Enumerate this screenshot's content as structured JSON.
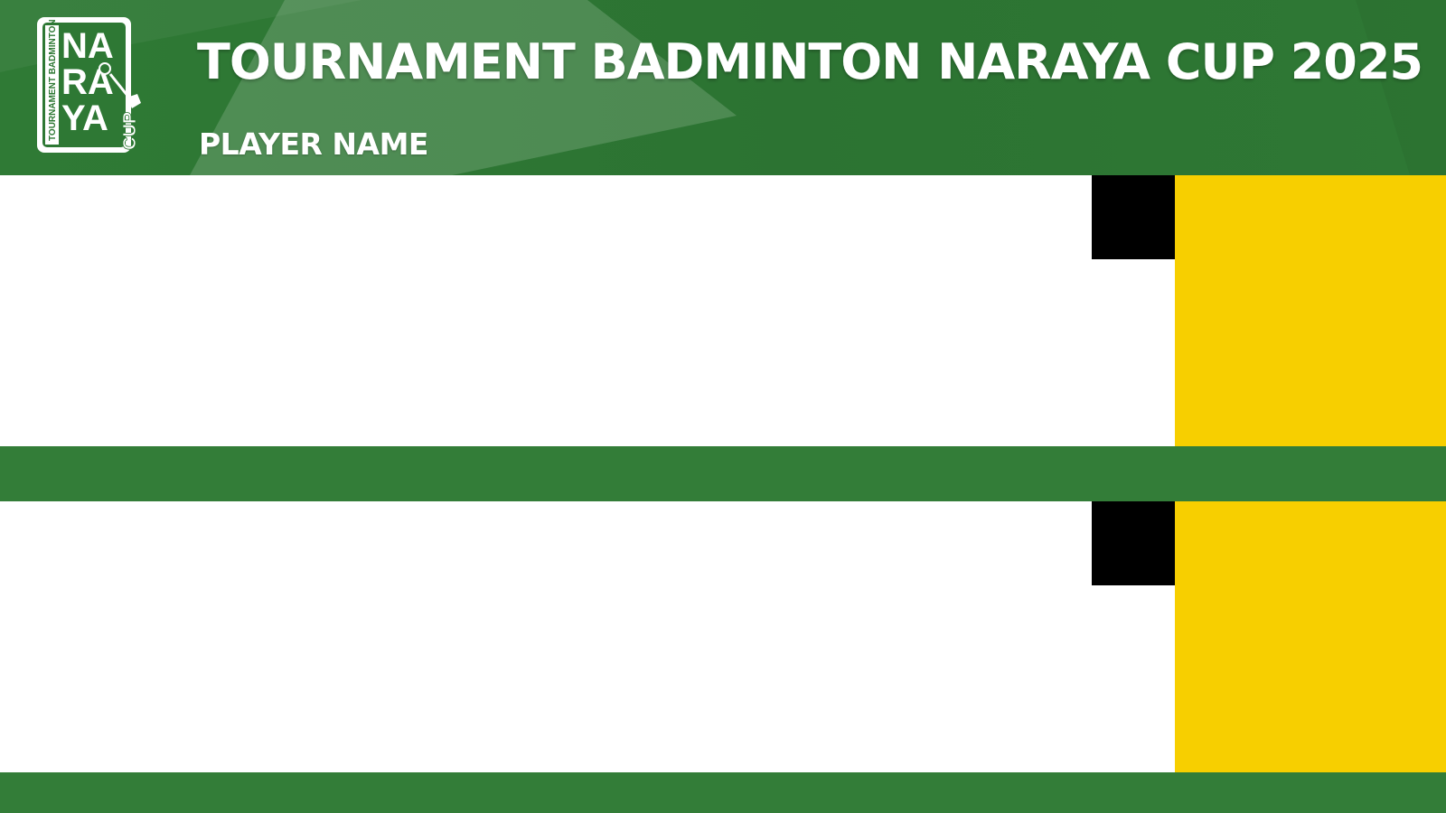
{
  "header": {
    "title": "TOURNAMENT BADMINTON NARAYA CUP 2025",
    "subtitle": "PLAYER NAME",
    "logo": {
      "icon": "naraya-cup-logo-icon",
      "text_side": "TOURNAMENT BADMINTON",
      "text_main": [
        "NA",
        "RA",
        "YA",
        "CUP"
      ]
    }
  },
  "players": [
    {
      "name": "",
      "score": "",
      "serving": true
    },
    {
      "name": "",
      "score": "",
      "serving": true
    }
  ],
  "colors": {
    "header_green": "#2e7834",
    "divider_green": "#337d38",
    "score_yellow": "#f7cf00",
    "serve_black": "#000000",
    "panel_white": "#ffffff"
  }
}
